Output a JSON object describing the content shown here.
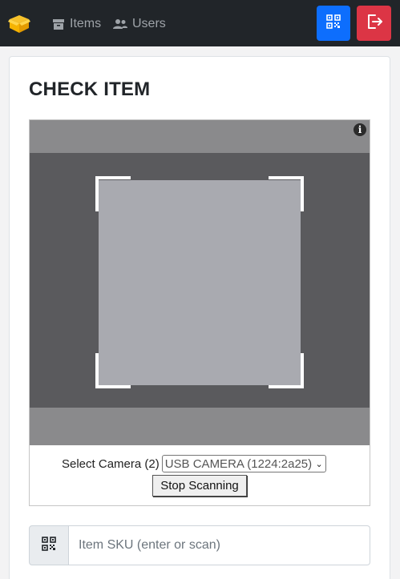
{
  "navbar": {
    "brand_icon": "box-icon",
    "items_label": "Items",
    "users_label": "Users",
    "scan_button_icon": "qr-code-icon",
    "logout_button_icon": "logout-icon",
    "colors": {
      "background": "#212529",
      "scan": "#0d6efd",
      "logout": "#dc3545",
      "brand": "#f5b301"
    }
  },
  "page": {
    "title": "CHECK ITEM"
  },
  "scanner": {
    "info_icon": "i",
    "camera_label": "Select Camera (2)",
    "camera_selected": "USB CAMERA (1224:2a25)",
    "stop_button_label": "Stop Scanning"
  },
  "sku": {
    "addon_icon": "qr-code-icon",
    "placeholder": "Item SKU (enter or scan)",
    "value": ""
  }
}
